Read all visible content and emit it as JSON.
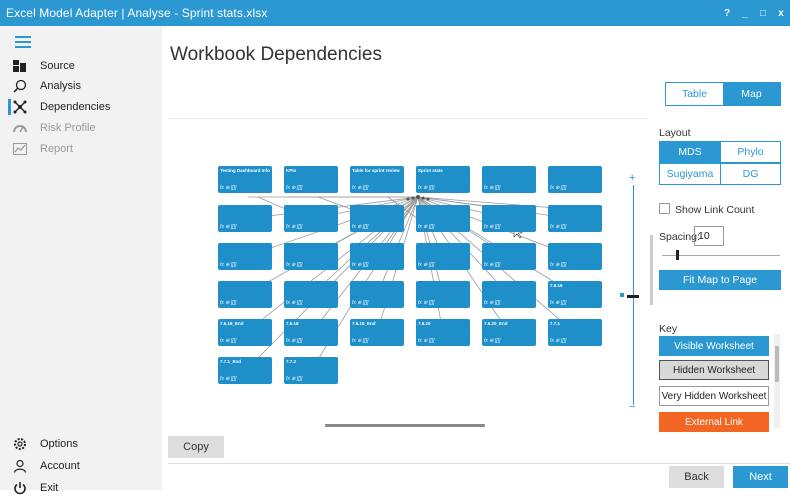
{
  "window": {
    "title": "Excel Model Adapter | Analyse - Sprint stats.xlsx",
    "help": "?",
    "minimize": "_",
    "maximize": "□",
    "close": "x"
  },
  "sidebar": {
    "items": [
      {
        "label": "Source",
        "icon": "source-icon"
      },
      {
        "label": "Analysis",
        "icon": "search-icon"
      },
      {
        "label": "Dependencies",
        "icon": "network-icon"
      },
      {
        "label": "Risk Profile",
        "icon": "risk-icon"
      },
      {
        "label": "Report",
        "icon": "report-icon"
      }
    ],
    "footer": [
      {
        "label": "Options",
        "icon": "gear-icon"
      },
      {
        "label": "Account",
        "icon": "user-icon"
      },
      {
        "label": "Exit",
        "icon": "power-icon"
      }
    ]
  },
  "main": {
    "title": "Workbook Dependencies"
  },
  "view_toggle": {
    "table": "Table",
    "map": "Map"
  },
  "layout": {
    "label": "Layout",
    "mds": "MDS",
    "phylo": "Phylo",
    "sugiyama": "Sugiyama",
    "dg": "DG"
  },
  "options": {
    "show_link_count": "Show Link Count",
    "spacing_label": "Spacing:",
    "spacing_value": "10",
    "fit_button": "Fit Map to Page"
  },
  "key": {
    "label": "Key",
    "visible": "Visible Worksheet",
    "hidden": "Hidden Worksheet",
    "very_hidden": "Very Hidden Worksheet",
    "external": "External Link"
  },
  "buttons": {
    "copy": "Copy",
    "back": "Back",
    "next": "Next"
  },
  "sheets": {
    "s0": "Testing Dashboard Info",
    "s1": "KPIs",
    "s2": "Table for sprint review",
    "s3": "Sprint stats",
    "s4": "7.6.16",
    "s5": "7.6.18_End",
    "s6": "7.5.18",
    "s7": "7.6.18_End",
    "s8": "7.6.20",
    "s9": "7.6.20_End",
    "s10": "7.7.1",
    "s11": "7.7.1_End",
    "s12": "7.7.2",
    "fx": "fx ⊕ [[]]"
  },
  "colors": {
    "accent": "#2b98d1",
    "external": "#f26522"
  }
}
